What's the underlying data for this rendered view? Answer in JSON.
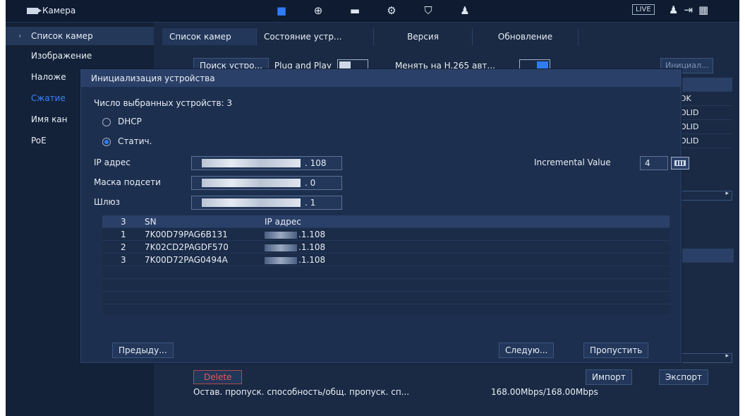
{
  "topbar": {
    "title": "Камера",
    "live_label": "LIVE",
    "icons": [
      "camera-icon",
      "network-icon",
      "storage-icon",
      "system-icon",
      "security-icon",
      "account-icon"
    ]
  },
  "sidebar": {
    "items": [
      {
        "label": "Список камер",
        "selected": true
      },
      {
        "label": "Изображение"
      },
      {
        "label": "Наложе"
      },
      {
        "label": "Сжатие",
        "accent": true
      },
      {
        "label": "Имя кан"
      },
      {
        "label": "PoE"
      }
    ]
  },
  "tabs": [
    "Список камер",
    "Состояние устр...",
    "Версия",
    "Обновление"
  ],
  "main": {
    "search_button": "Поиск устро...",
    "plug_and_play": "Plug and Play",
    "h265_label": "Менять на H.265 авт...",
    "init_button": "Инициал...",
    "bg_cells": [
      "",
      "DK",
      "OLID",
      "OLID",
      "OLID"
    ],
    "delete_button": "Delete",
    "bandwidth_label": "Остав. пропуск. способность/общ. пропуск. сп...",
    "bandwidth_value": "168.00Mbps/168.00Mbps",
    "import_button": "Импорт",
    "export_button": "Экспорт"
  },
  "modal": {
    "title": "Инициализация устройства",
    "selected_count": "Число выбранных устройств: 3",
    "dhcp_label": "DHCP",
    "static_label": "Статич.",
    "ip_label": "IP адрес",
    "ip_suffix": ". 108",
    "mask_label": "Маска подсети",
    "mask_suffix": ". 0",
    "gateway_label": "Шлюз",
    "gateway_suffix": ". 1",
    "incremental_label": "Incremental Value",
    "incremental_value": "4",
    "table": {
      "headers": [
        "3",
        "SN",
        "IP адрес"
      ],
      "rows": [
        {
          "num": "1",
          "sn": "7K00D79PAG6B131",
          "ip": ".1.108"
        },
        {
          "num": "2",
          "sn": "7K02CD2PAGDF570",
          "ip": ".1.108"
        },
        {
          "num": "3",
          "sn": "7K00D72PAG0494A",
          "ip": ".1.108"
        }
      ]
    },
    "prev_button": "Предыду...",
    "next_button": "Следую...",
    "skip_button": "Пропустить"
  }
}
